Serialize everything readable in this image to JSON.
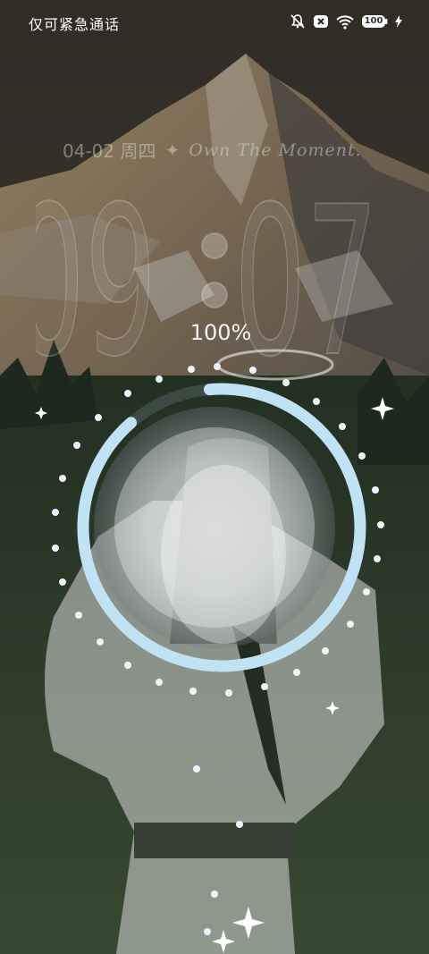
{
  "status_bar": {
    "carrier_text": "仅可紧急通话",
    "icons": [
      "mute-icon",
      "no-sim-icon",
      "wifi-icon",
      "battery-full-icon",
      "charging-bolt-icon"
    ],
    "battery_label": "100"
  },
  "lockscreen": {
    "date": "04-02 周四",
    "slogan": "Own The Moment.",
    "clock_hours": "09",
    "clock_minutes": "07"
  },
  "charging": {
    "percent_label": "100%",
    "level": 1.0,
    "ring_color": "#bfe3f5"
  },
  "colors": {
    "sky": "#23272f",
    "mountain_light": "#c9c3b8",
    "mountain_shadow": "#5e5a55",
    "forest": "#33452f",
    "accent": "#bfe3f5"
  }
}
